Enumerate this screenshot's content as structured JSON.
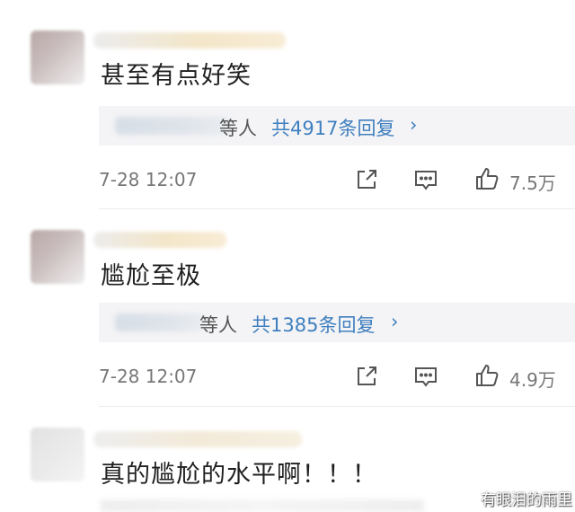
{
  "comments": [
    {
      "text": "甚至有点好笑",
      "reply_suffix": "等人",
      "reply_count": "共4917条回复",
      "time": "7-28 12:07",
      "likes": "7.5万"
    },
    {
      "text": "尴尬至极",
      "reply_suffix": "等人",
      "reply_count": "共1385条回复",
      "time": "7-28 12:07",
      "likes": "4.9万"
    },
    {
      "text": "真的尴尬的水平啊！！！"
    }
  ],
  "icons": {
    "share": "share-icon",
    "comment": "comment-icon",
    "like": "thumbs-up-icon",
    "chevron": "chevron-right-icon"
  },
  "chevron_glyph": "›",
  "watermark": "有眼泪的雨里",
  "colors": {
    "link": "#3f7fbf",
    "meta": "#777777",
    "reply_bg": "#f4f4f6"
  }
}
